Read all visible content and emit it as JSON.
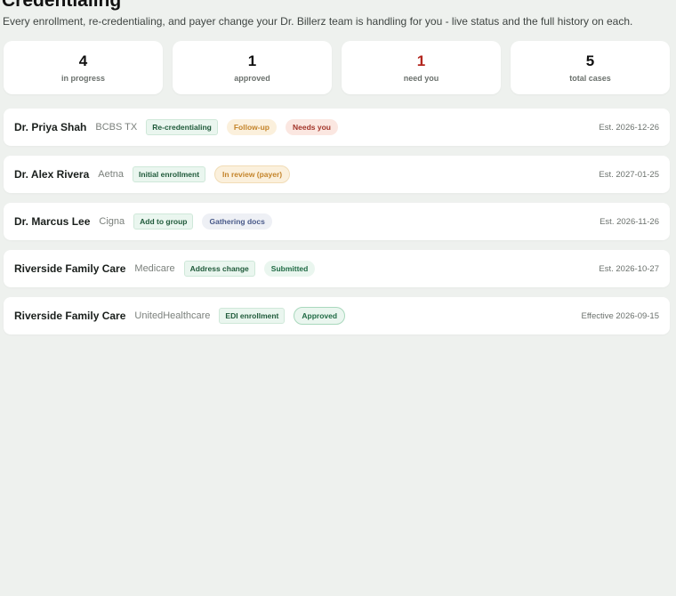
{
  "header": {
    "title": "Credentialing",
    "subtitle": "Every enrollment, re-credentialing, and payer change your Dr. Billerz team is handling for you - live status and the full history on each."
  },
  "stats": [
    {
      "value": "4",
      "label": "in progress"
    },
    {
      "value": "1",
      "label": "approved"
    },
    {
      "value": "1",
      "label": "need you"
    },
    {
      "value": "5",
      "label": "total cases"
    }
  ],
  "cases": [
    {
      "name": "Dr. Priya Shah",
      "payer": "BCBS TX",
      "type": "Re-credentialing",
      "status": "Follow-up",
      "extra": "Needs you",
      "date": "Est. 2026-12-26"
    },
    {
      "name": "Dr. Alex Rivera",
      "payer": "Aetna",
      "type": "Initial enrollment",
      "status": "In review (payer)",
      "date": "Est. 2027-01-25"
    },
    {
      "name": "Dr. Marcus Lee",
      "payer": "Cigna",
      "type": "Add to group",
      "status": "Gathering docs",
      "date": "Est. 2026-11-26"
    },
    {
      "name": "Riverside Family Care",
      "payer": "Medicare",
      "type": "Address change",
      "status": "Submitted",
      "date": "Est. 2026-10-27"
    },
    {
      "name": "Riverside Family Care",
      "payer": "UnitedHealthcare",
      "type": "EDI enrollment",
      "status": "Approved",
      "date": "Effective 2026-09-15"
    }
  ],
  "colors": {
    "background": "#eef1ee",
    "alert": "#b3261e",
    "type_badge": "#eaf6ef",
    "followup_badge": "#fbf0dc",
    "needs_badge": "#fbe7e1"
  }
}
